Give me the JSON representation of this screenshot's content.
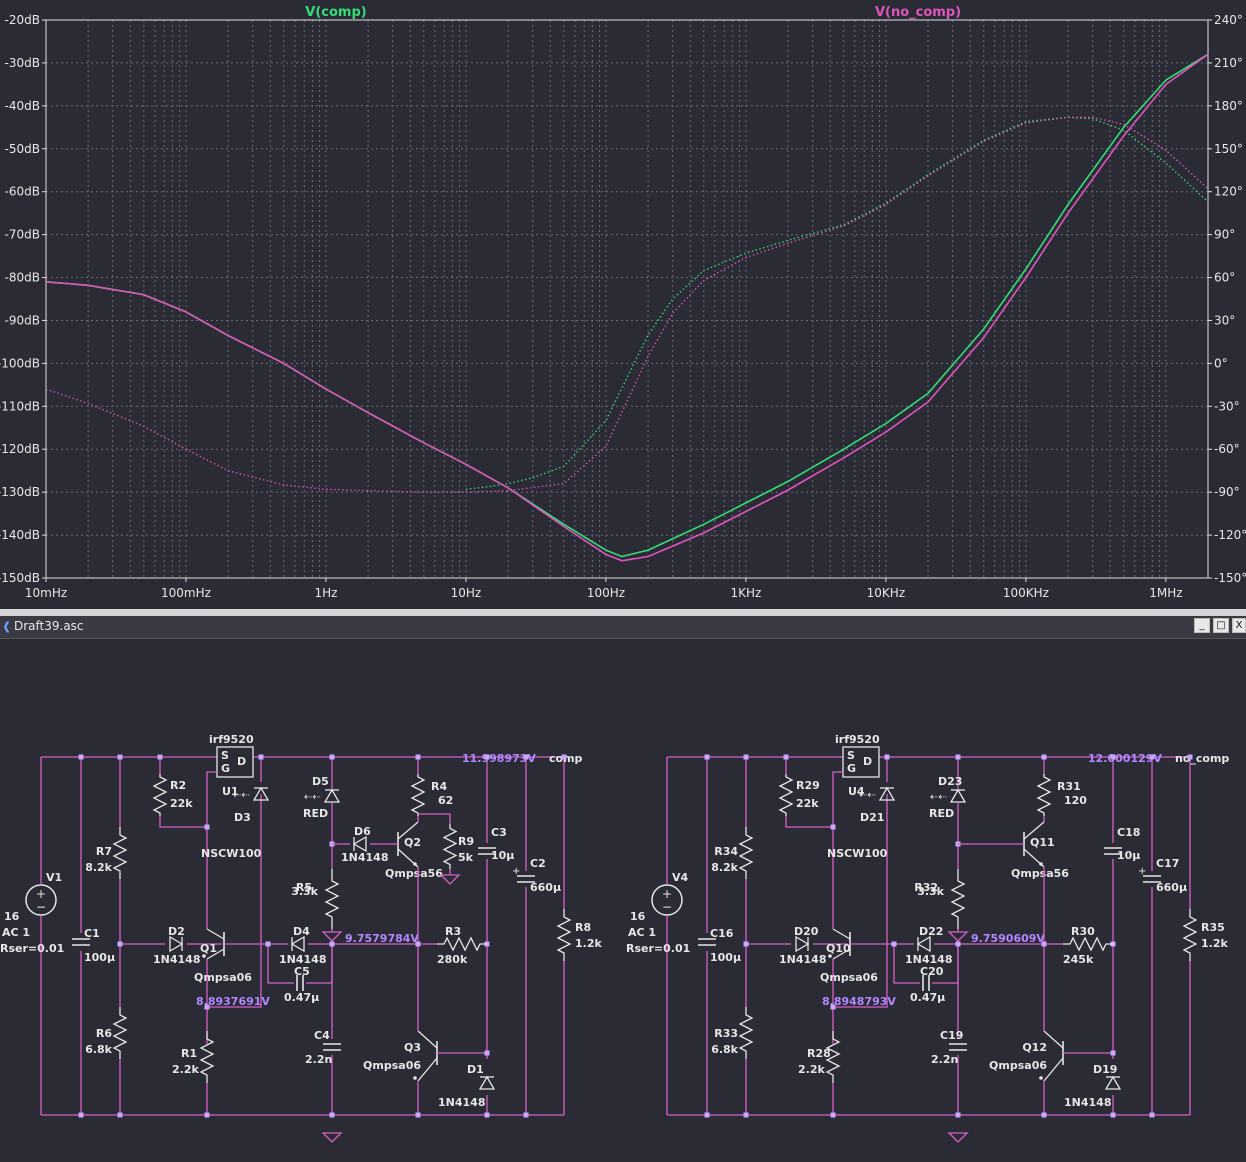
{
  "colors": {
    "background": "#2b2b35",
    "trace_comp": "#33dd77",
    "trace_no_comp": "#dd55bb",
    "grid": "#6a6a7a",
    "wire": "#d660c8",
    "component": "#e6e6e6",
    "junction": "#c8a8ff",
    "net_voltage": "#b088ff"
  },
  "plot": {
    "trace_labels": {
      "comp": "V(comp)",
      "no_comp": "V(no_comp)"
    }
  },
  "chart_data": {
    "type": "line",
    "title": "",
    "x_scale": "log",
    "xlim_hz": [
      0.01,
      2000000
    ],
    "ylim_db": [
      -150,
      -20
    ],
    "y2lim_deg": [
      -150,
      240
    ],
    "x_tick_labels": [
      "10mHz",
      "100mHz",
      "1Hz",
      "10Hz",
      "100Hz",
      "1KHz",
      "10KHz",
      "100KHz",
      "1MHz"
    ],
    "y_tick_labels": [
      "-20dB",
      "-30dB",
      "-40dB",
      "-50dB",
      "-60dB",
      "-70dB",
      "-80dB",
      "-90dB",
      "-100dB",
      "-110dB",
      "-120dB",
      "-130dB",
      "-140dB",
      "-150dB"
    ],
    "y2_tick_labels": [
      "240°",
      "210°",
      "180°",
      "150°",
      "120°",
      "90°",
      "60°",
      "30°",
      "0°",
      "-30°",
      "-60°",
      "-90°",
      "-120°",
      "-150°"
    ],
    "grid": true,
    "series": [
      {
        "name": "V(comp)",
        "magnitude_db": {
          "x": [
            0.01,
            0.02,
            0.05,
            0.1,
            0.2,
            0.5,
            1,
            2,
            5,
            10,
            20,
            50,
            100,
            130,
            200,
            500,
            1000,
            2000,
            5000,
            10000,
            20000,
            50000,
            100000,
            200000,
            500000,
            1000000,
            2000000
          ],
          "y": [
            -81,
            -81.8,
            -84,
            -88,
            -93.5,
            -100,
            -106,
            -111.5,
            -118.5,
            -123.5,
            -129,
            -137.5,
            -143.5,
            -145,
            -143.5,
            -137.5,
            -132.5,
            -127.5,
            -120,
            -114,
            -107,
            -92,
            -78,
            -63,
            -45,
            -34,
            -28
          ]
        },
        "phase_deg": {
          "x": [
            10,
            15,
            20,
            30,
            50,
            100,
            200,
            300,
            500,
            1000,
            2000,
            5000,
            10000,
            20000,
            50000,
            100000,
            200000,
            300000,
            500000,
            1000000,
            2000000
          ],
          "y": [
            -88,
            -86,
            -84,
            -80,
            -72,
            -40,
            20,
            45,
            65,
            77,
            86,
            97,
            112,
            132,
            156,
            169,
            172,
            171,
            163,
            140,
            113
          ]
        }
      },
      {
        "name": "V(no_comp)",
        "magnitude_db": {
          "x": [
            0.01,
            0.02,
            0.05,
            0.1,
            0.2,
            0.5,
            1,
            2,
            5,
            10,
            20,
            50,
            100,
            130,
            200,
            500,
            1000,
            2000,
            5000,
            10000,
            20000,
            50000,
            100000,
            200000,
            500000,
            1000000,
            2000000
          ],
          "y": [
            -81,
            -81.8,
            -84,
            -88,
            -93.5,
            -100,
            -106,
            -111.5,
            -118.5,
            -123.5,
            -129,
            -138,
            -144.5,
            -146,
            -145,
            -139.5,
            -134.5,
            -129.5,
            -122,
            -116,
            -109,
            -94,
            -80,
            -65,
            -47,
            -35,
            -28
          ]
        },
        "phase_deg": {
          "x": [
            0.01,
            0.02,
            0.05,
            0.1,
            0.2,
            0.5,
            1,
            2,
            5,
            10,
            20,
            50,
            100,
            200,
            300,
            500,
            1000,
            2000,
            5000,
            10000,
            20000,
            50000,
            100000,
            200000,
            300000,
            500000,
            1000000,
            2000000
          ],
          "y": [
            -18,
            -28,
            -44,
            -60,
            -75,
            -85,
            -88,
            -89,
            -90,
            -90,
            -89,
            -84,
            -58,
            5,
            35,
            58,
            74,
            84,
            96,
            111,
            131,
            155,
            168,
            172,
            172,
            167,
            149,
            122
          ]
        }
      }
    ]
  },
  "schematic": {
    "window_title": "Draft39.asc",
    "controls": {
      "minimize": "_",
      "maximize": "□",
      "close": "X"
    },
    "nets": {
      "comp": "comp",
      "no_comp": "no_comp",
      "out_comp": "11.998973V",
      "out_no_comp": "12.000129V",
      "mid_comp": "9.7579784V",
      "mid_no_comp": "9.7590609V",
      "low_comp": "8.8937691V",
      "low_no_comp": "8.8948793V"
    },
    "left": {
      "V1": {
        "ref": "V1",
        "l1": "16",
        "l2": "AC 1",
        "l3": "Rser=0.01"
      },
      "U1": {
        "ref": "U1",
        "model": "irf9520",
        "pin_s": "S",
        "pin_g": "G",
        "pin_d": "D"
      },
      "R2": {
        "ref": "R2",
        "val": "22k"
      },
      "R7": {
        "ref": "R7",
        "val": "8.2k"
      },
      "R6": {
        "ref": "R6",
        "val": "6.8k"
      },
      "R1": {
        "ref": "R1",
        "val": "2.2k"
      },
      "C1": {
        "ref": "C1",
        "val": "100µ"
      },
      "D2": {
        "ref": "D2",
        "val": "1N4148"
      },
      "Q1": {
        "ref": "Q1",
        "val": "Qmpsa06"
      },
      "D3": {
        "ref": "D3",
        "val": "NSCW100"
      },
      "D5": {
        "ref": "D5",
        "val": "RED"
      },
      "D6": {
        "ref": "D6",
        "val": "1N4148"
      },
      "Q2": {
        "ref": "Q2",
        "val": "Qmpsa56"
      },
      "R4": {
        "ref": "R4",
        "val": "62"
      },
      "R9": {
        "ref": "R9",
        "val": "5k"
      },
      "R5": {
        "ref": "R5",
        "val": "3.3k"
      },
      "D4": {
        "ref": "D4",
        "val": "1N4148"
      },
      "C5": {
        "ref": "C5",
        "val": "0.47µ"
      },
      "R3": {
        "ref": "R3",
        "val": "280k"
      },
      "C3": {
        "ref": "C3",
        "val": "10µ"
      },
      "C2": {
        "ref": "C2",
        "val": "660µ"
      },
      "R8": {
        "ref": "R8",
        "val": "1.2k"
      },
      "C4": {
        "ref": "C4",
        "val": "2.2n"
      },
      "Q3": {
        "ref": "Q3",
        "val": "Qmpsa06"
      },
      "D1": {
        "ref": "D1",
        "val": "1N4148"
      }
    },
    "right": {
      "V4": {
        "ref": "V4",
        "l1": "16",
        "l2": "AC 1",
        "l3": "Rser=0.01"
      },
      "U4": {
        "ref": "U4",
        "model": "irf9520",
        "pin_s": "S",
        "pin_g": "G",
        "pin_d": "D"
      },
      "R29": {
        "ref": "R29",
        "val": "22k"
      },
      "R34": {
        "ref": "R34",
        "val": "8.2k"
      },
      "R33": {
        "ref": "R33",
        "val": "6.8k"
      },
      "R28": {
        "ref": "R28",
        "val": "2.2k"
      },
      "C16": {
        "ref": "C16",
        "val": "100µ"
      },
      "D20": {
        "ref": "D20",
        "val": "1N4148"
      },
      "Q10": {
        "ref": "Q10",
        "val": "Qmpsa06"
      },
      "D21": {
        "ref": "D21",
        "val": "NSCW100"
      },
      "D23": {
        "ref": "D23",
        "val": "RED"
      },
      "R31": {
        "ref": "R31",
        "val": "120"
      },
      "Q11": {
        "ref": "Q11",
        "val": "Qmpsa56"
      },
      "R32": {
        "ref": "R32",
        "val": "3.3k"
      },
      "D22": {
        "ref": "D22",
        "val": "1N4148"
      },
      "C20": {
        "ref": "C20",
        "val": "0.47µ"
      },
      "R30": {
        "ref": "R30",
        "val": "245k"
      },
      "C18": {
        "ref": "C18",
        "val": "10µ"
      },
      "C17": {
        "ref": "C17",
        "val": "660µ"
      },
      "R35": {
        "ref": "R35",
        "val": "1.2k"
      },
      "C19": {
        "ref": "C19",
        "val": "2.2n"
      },
      "Q12": {
        "ref": "Q12",
        "val": "Qmpsa06"
      },
      "D19": {
        "ref": "D19",
        "val": "1N4148"
      }
    }
  }
}
